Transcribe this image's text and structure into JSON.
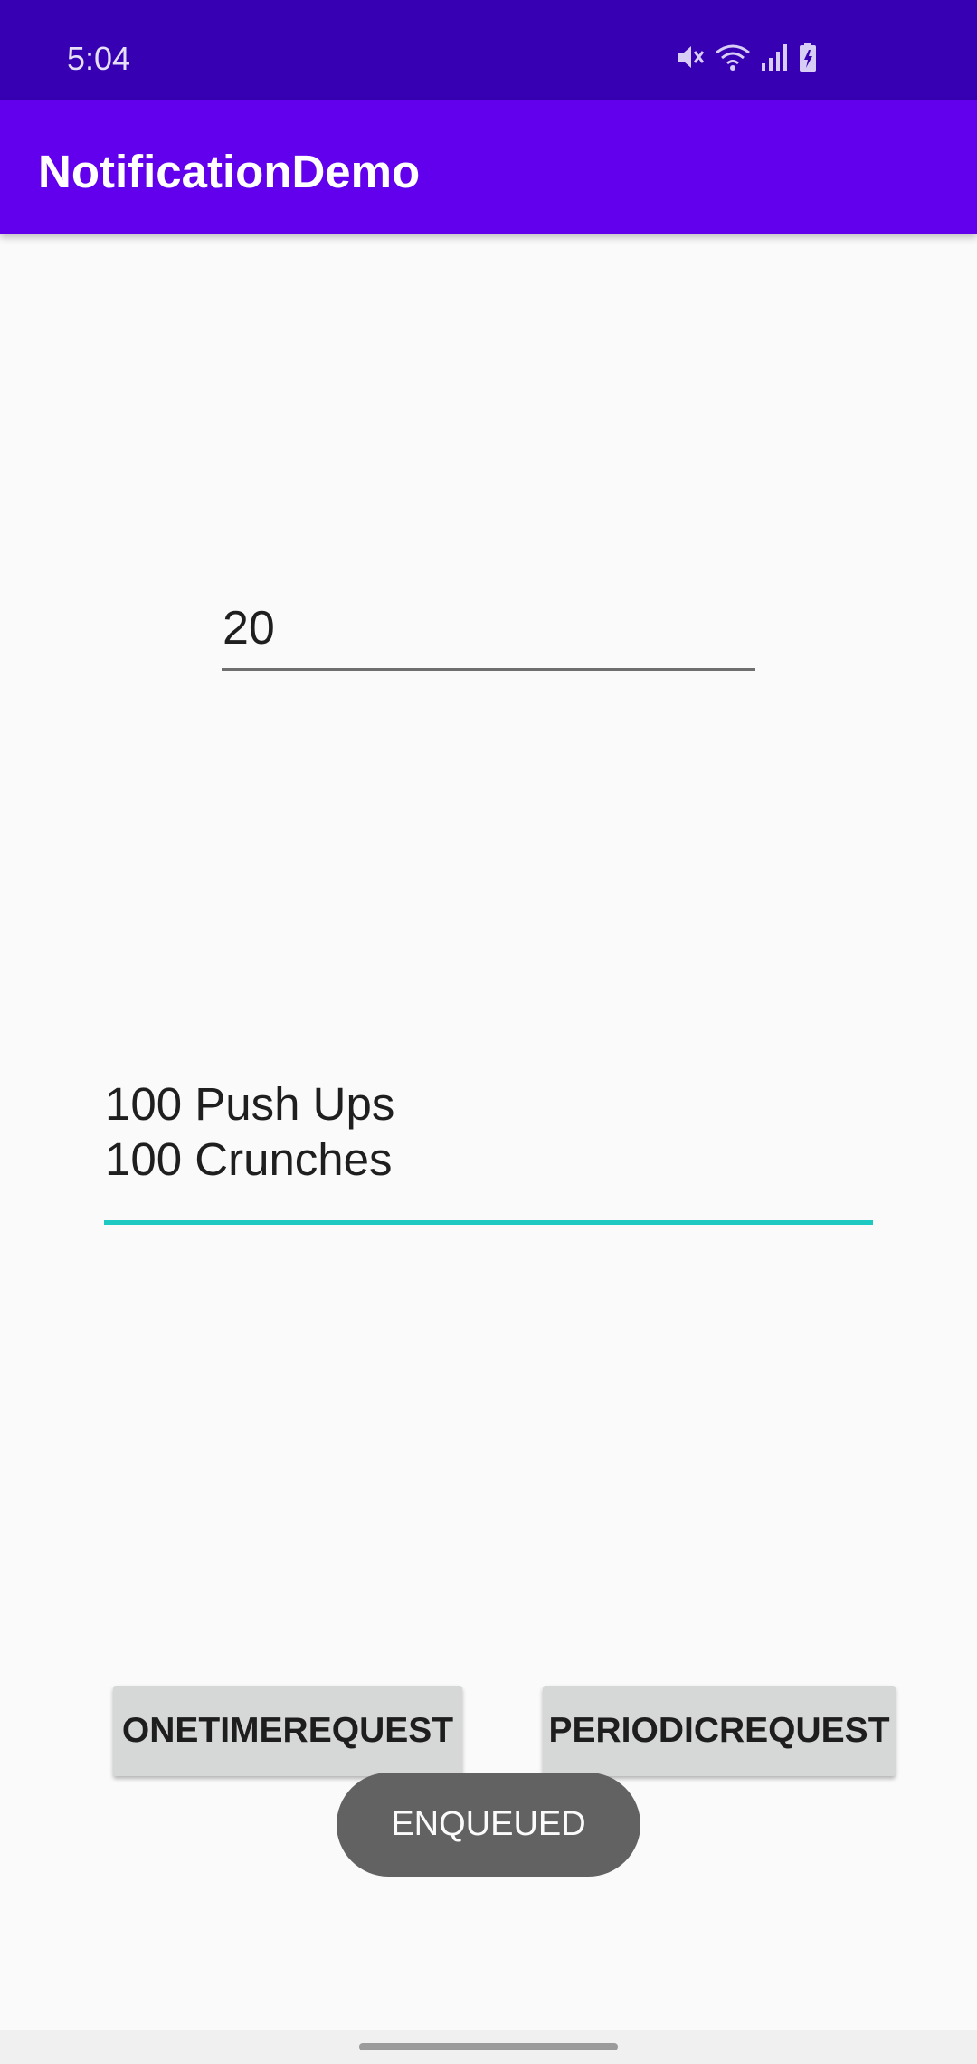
{
  "status_bar": {
    "time": "5:04",
    "icons": [
      "mute-icon",
      "wifi-icon",
      "signal-icon",
      "battery-charging-icon"
    ]
  },
  "app_bar": {
    "title": "NotificationDemo",
    "background": "#6200ee"
  },
  "number_input": {
    "value": "20"
  },
  "workout_input": {
    "lines": [
      "100 Push Ups",
      "100 Crunches"
    ],
    "focused": true,
    "accent": "#1dc9c0"
  },
  "buttons": {
    "one_time": "ONETIMEREQUEST",
    "periodic": "PERIODICREQUEST"
  },
  "toast": {
    "message": "ENQUEUED"
  },
  "colors": {
    "status_bar": "#3700b3",
    "background": "#fafafa"
  }
}
